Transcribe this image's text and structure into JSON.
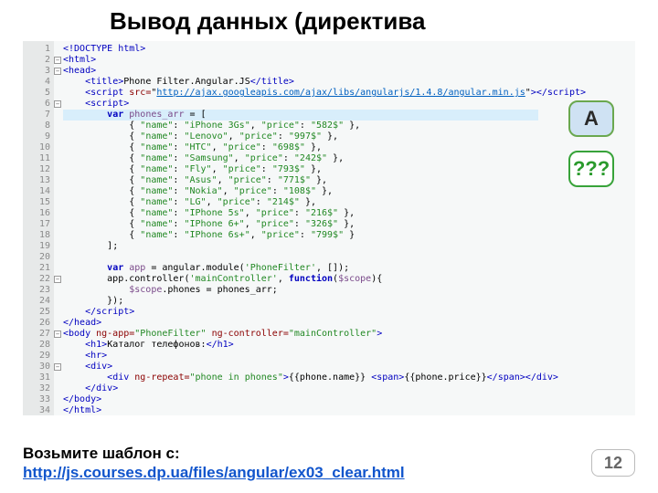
{
  "title": "Вывод данных (директива",
  "badges": {
    "a": "A",
    "q": "???"
  },
  "code": {
    "doctype": "<!DOCTYPE html>",
    "html_open": "<html>",
    "head_open": "<head>",
    "title_line": {
      "open": "<title>",
      "text": "Phone Filter.Angular.JS",
      "close": "</title>"
    },
    "script_src": {
      "open": "<script ",
      "attr": "src=",
      "url": "http://ajax.googleapis.com/ajax/libs/angularjs/1.4.8/angular.min.js",
      "close": "></script>"
    },
    "script_open": "<script>",
    "var_decl": "var phones_arr = [",
    "phones": [
      {
        "name": "iPhone 3Gs",
        "price": "582$"
      },
      {
        "name": "Lenovo",
        "price": "997$"
      },
      {
        "name": "HTC",
        "price": "698$"
      },
      {
        "name": "Samsung",
        "price": "242$"
      },
      {
        "name": "Fly",
        "price": "793$"
      },
      {
        "name": "Asus",
        "price": "771$"
      },
      {
        "name": "Nokia",
        "price": "108$"
      },
      {
        "name": "LG",
        "price": "214$"
      },
      {
        "name": "IPhone 5s",
        "price": "216$"
      },
      {
        "name": "IPhone 6+",
        "price": "326$"
      },
      {
        "name": "IPhone 6s+",
        "price": "799$"
      }
    ],
    "arr_close": "];",
    "module_line": "var app = angular.module('PhoneFilter', []);",
    "controller_line": "app.controller('mainController', function($scope){",
    "scope_line": "$scope.phones = phones_arr;",
    "controller_close": "});",
    "script_close": "</script>",
    "head_close": "</head>",
    "body_open": {
      "open": "<body ",
      "app": "ng-app=",
      "appv": "PhoneFilter",
      "ctrl": " ng-controller=",
      "ctrlv": "mainController",
      "close": ">"
    },
    "h1": {
      "open": "<h1>",
      "text": "Каталог телефонов:",
      "close": "</h1>"
    },
    "hr": "<hr>",
    "div_open": "<div>",
    "repeat": {
      "open": "<div ",
      "attr": "ng-repeat=",
      "val": "phone in phones",
      "mid": ">",
      "b1": "{{phone.name}}",
      "span_o": " <span>",
      "b2": "{{phone.price}}",
      "span_c": "</span></div>"
    },
    "div_close": "</div>",
    "body_close": "</body>",
    "html_close": "</html>"
  },
  "footer": {
    "label": "Возьмите шаблон с:",
    "url": "http://js.courses.dp.ua/files/angular/ex03_clear.html"
  },
  "page_number": "12"
}
